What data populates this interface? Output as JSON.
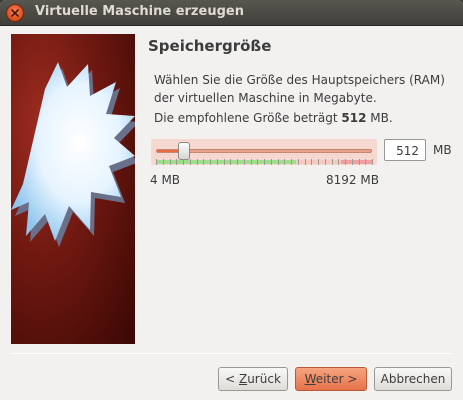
{
  "window": {
    "title": "Virtuelle Maschine erzeugen"
  },
  "page": {
    "heading": "Speichergröße",
    "description": "Wählen Sie die Größe des Hauptspeichers (RAM) der virtuellen Maschine in Megabyte.",
    "recommended_prefix": "Die empfohlene Größe beträgt",
    "recommended_value": "512",
    "recommended_suffix": "MB."
  },
  "memory": {
    "value": "512",
    "unit": "MB",
    "min_label": "4 MB",
    "max_label": "8192 MB",
    "slider_min": 4,
    "slider_max": 8192,
    "slider_value": 512
  },
  "buttons": {
    "back_mnemonic": "Z",
    "back_rest": "urück",
    "back_prefix": "< ",
    "next_mnemonic": "W",
    "next_rest": "eiter >",
    "cancel": "Abbrechen"
  },
  "colors": {
    "accent": "#e96a3e",
    "titlebar": "#403f3a"
  },
  "icons": {
    "close": "close-icon",
    "wizard_image": "starburst-illustration"
  }
}
